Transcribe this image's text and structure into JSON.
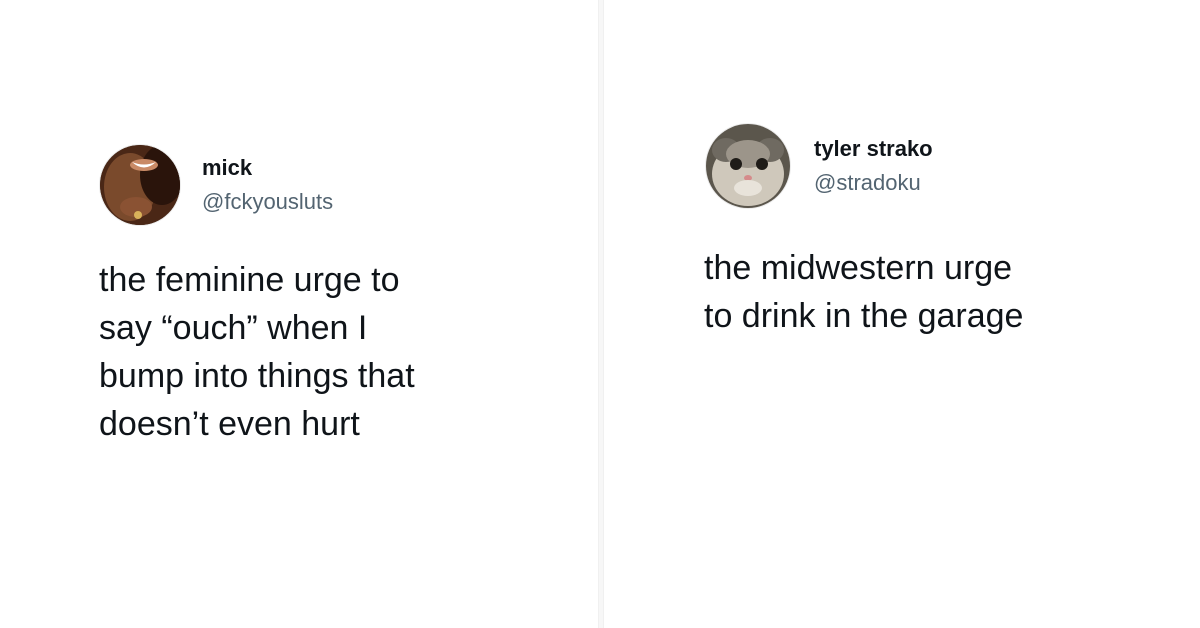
{
  "tweets": [
    {
      "display_name": "mick",
      "handle": "@fckyousluts",
      "avatar_icon": "person-photo-avatar",
      "text": "the feminine urge to\nsay “ouch” when I\nbump into things that\ndoesn’t even hurt"
    },
    {
      "display_name": "tyler strako",
      "handle": "@stradoku",
      "avatar_icon": "cat-photo-avatar",
      "text": "the midwestern urge\nto drink in the garage"
    }
  ],
  "colors": {
    "text_primary": "#0f1419",
    "text_secondary": "#536471",
    "background": "#ffffff"
  }
}
